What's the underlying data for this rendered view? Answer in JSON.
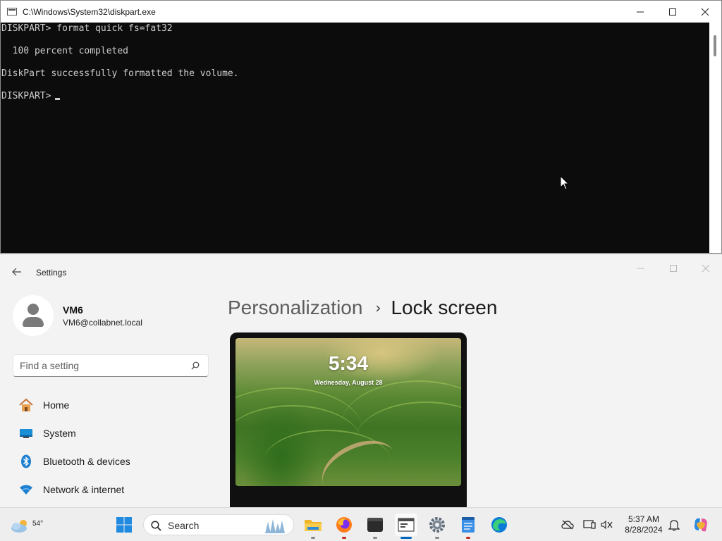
{
  "console": {
    "title": "C:\\Windows\\System32\\diskpart.exe",
    "lines": [
      "DISKPART> format quick fs=fat32",
      "",
      "  100 percent completed",
      "",
      "DiskPart successfully formatted the volume.",
      "",
      "DISKPART>"
    ]
  },
  "settings": {
    "title": "Settings",
    "user": {
      "name": "VM6",
      "email": "VM6@collabnet.local"
    },
    "search_placeholder": "Find a setting",
    "nav": [
      {
        "label": "Home",
        "icon": "home-icon"
      },
      {
        "label": "System",
        "icon": "system-icon"
      },
      {
        "label": "Bluetooth & devices",
        "icon": "bluetooth-icon"
      },
      {
        "label": "Network & internet",
        "icon": "wifi-icon"
      }
    ],
    "breadcrumb": {
      "parent": "Personalization",
      "separator": "›",
      "current": "Lock screen"
    },
    "preview": {
      "time": "5:34",
      "date": "Wednesday, August 28"
    }
  },
  "taskbar": {
    "weather_temp": "54°",
    "search_label": "Search",
    "clock_time": "5:37 AM",
    "clock_date": "8/28/2024",
    "apps": [
      "windows-start-icon",
      "file-explorer-icon",
      "firefox-icon",
      "terminal-icon",
      "diskpart-icon",
      "settings-gear-icon",
      "notepad-icon",
      "edge-icon"
    ]
  },
  "colors": {
    "console_bg": "#0c0c0c",
    "console_text": "#cccccc",
    "settings_bg": "#f3f3f3",
    "accent": "#0067c0"
  }
}
